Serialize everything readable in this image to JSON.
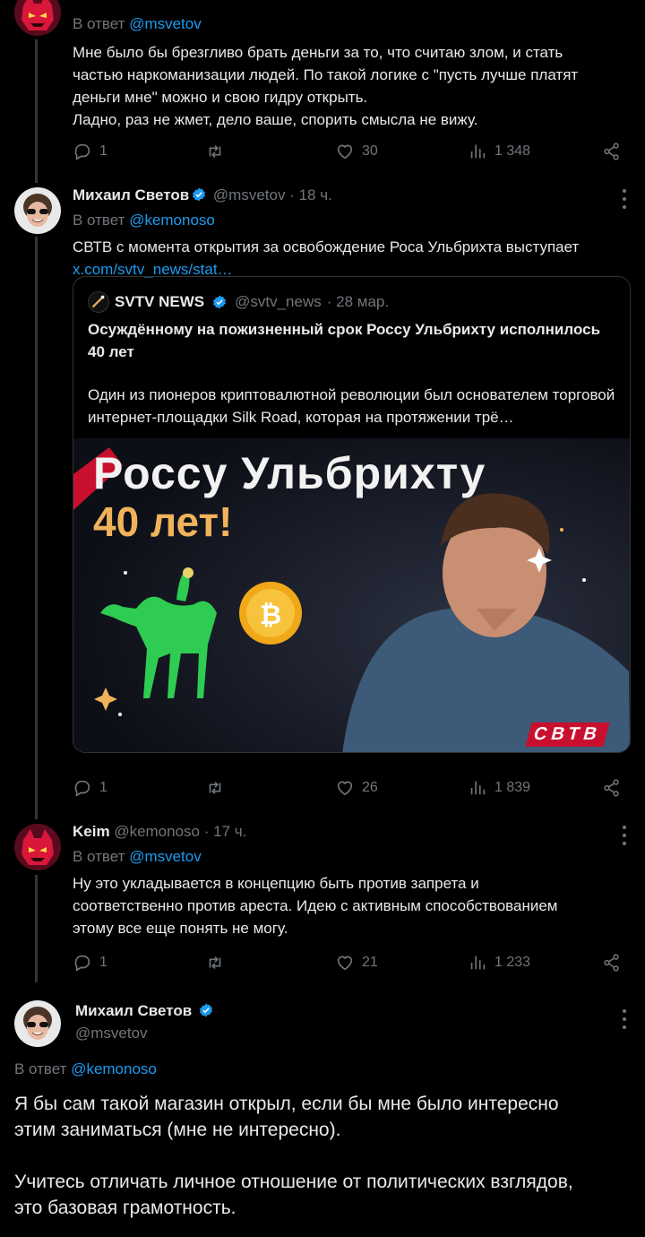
{
  "tweet1": {
    "reply_prefix": "В ответ",
    "reply_mention": "@msvetov",
    "text_lines": [
      "Мне было бы брезгливо брать деньги за то, что считаю злом, и стать",
      "частью наркоманизации людей. По такой логике с \"пусть лучше платят",
      "деньги мне\" можно и свою гидру открыть.",
      "Ладно, раз не жмет, дело ваше, спорить смысла не вижу."
    ],
    "replies": "1",
    "retweets": "",
    "likes": "30",
    "views": "1 348"
  },
  "tweet2": {
    "name": "Михаил Светов",
    "handle": "@msvetov",
    "time": "· 18 ч.",
    "reply_prefix": "В ответ",
    "reply_mention": "@kemonoso",
    "text": "СВТВ с момента открытия за освобождение Роса Ульбрихта выступает",
    "link": "x.com/svtv_news/stat…",
    "quote": {
      "name": "SVTV NEWS",
      "handle": "@svtv_news",
      "time": "· 28 мар.",
      "title": "Осуждённому на пожизненный срок Россу Ульбрихту исполнилось 40 лет",
      "text": "Один из пионеров криптовалютной революции был основателем торговой интернет-площадки Silk Road, которая на протяжении трё…",
      "image_line1": "Россу Ульбрихту",
      "image_line2": "40 лет!",
      "image_brand": "СВТВ"
    },
    "replies": "1",
    "retweets": "",
    "likes": "26",
    "views": "1 839"
  },
  "tweet3": {
    "name": "Keim",
    "handle": "@kemonoso",
    "time": "· 17 ч.",
    "reply_prefix": "В ответ",
    "reply_mention": "@msvetov",
    "text_lines": [
      "Ну это укладывается в концепцию быть против запрета и",
      "соответственно против ареста.  Идею с активным способствованием",
      "этому все еще понять не могу."
    ],
    "replies": "1",
    "retweets": "",
    "likes": "21",
    "views": "1 233"
  },
  "main_tweet": {
    "name": "Михаил Светов",
    "handle": "@msvetov",
    "reply_prefix": "В ответ",
    "reply_mention": "@kemonoso",
    "paragraph1_lines": [
      "Я бы сам такой магазин открыл, если бы мне было интересно",
      "этим заниматься (мне не интересно)."
    ],
    "paragraph2_lines": [
      "Учитесь отличать личное отношение от политических взглядов,",
      "это базовая грамотность."
    ]
  },
  "colors": {
    "background": "#000000",
    "text": "#e7e9ea",
    "secondary": "#71767b",
    "accent": "#1d9bf0",
    "border": "#2f3336"
  }
}
